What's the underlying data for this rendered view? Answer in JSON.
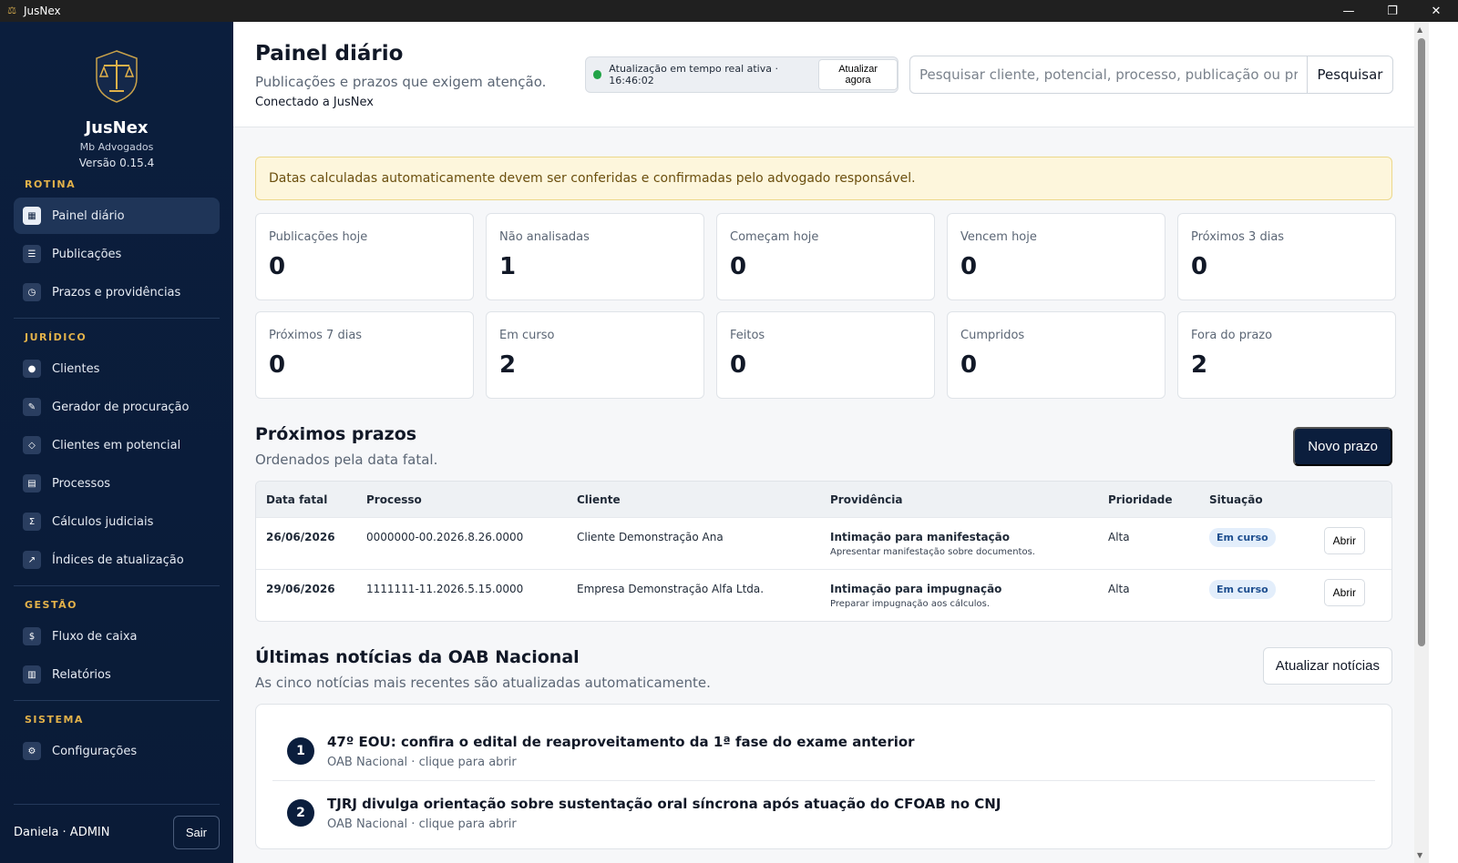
{
  "window": {
    "title": "JusNex",
    "minimize": "—",
    "restore": "❐",
    "close": "✕"
  },
  "sidebar": {
    "brand_name": "JusNex",
    "firm": "Mb Advogados",
    "version": "Versão 0.15.4",
    "sections": {
      "rotina": "ROTINA",
      "juridico": "JURÍDICO",
      "gestao": "GESTÃO",
      "sistema": "SISTEMA"
    },
    "items": {
      "painel": "Painel diário",
      "publicacoes": "Publicações",
      "prazos": "Prazos e providências",
      "clientes": "Clientes",
      "procuracao": "Gerador de procuração",
      "potencial": "Clientes em potencial",
      "processos": "Processos",
      "calculos": "Cálculos judiciais",
      "indices": "Índices de atualização",
      "fluxo": "Fluxo de caixa",
      "relatorios": "Relatórios",
      "config": "Configurações"
    },
    "user": "Daniela · ADMIN",
    "logout": "Sair"
  },
  "header": {
    "title": "Painel diário",
    "subtitle": "Publicações e prazos que exigem atenção.",
    "connection": "Conectado a JusNex",
    "realtime": "Atualização em tempo real ativa · 16:46:02",
    "refresh_now": "Atualizar agora",
    "search_placeholder": "Pesquisar cliente, potencial, processo, publicação ou prazo",
    "search_button": "Pesquisar"
  },
  "alert": "Datas calculadas automaticamente devem ser conferidas e confirmadas pelo advogado responsável.",
  "stats": [
    {
      "label": "Publicações hoje",
      "value": "0"
    },
    {
      "label": "Não analisadas",
      "value": "1"
    },
    {
      "label": "Começam hoje",
      "value": "0"
    },
    {
      "label": "Vencem hoje",
      "value": "0"
    },
    {
      "label": "Próximos 3 dias",
      "value": "0"
    },
    {
      "label": "Próximos 7 dias",
      "value": "0"
    },
    {
      "label": "Em curso",
      "value": "2"
    },
    {
      "label": "Feitos",
      "value": "0"
    },
    {
      "label": "Cumpridos",
      "value": "0"
    },
    {
      "label": "Fora do prazo",
      "value": "2"
    }
  ],
  "deadlines": {
    "title": "Próximos prazos",
    "subtitle": "Ordenados pela data fatal.",
    "new_button": "Novo prazo",
    "columns": [
      "Data fatal",
      "Processo",
      "Cliente",
      "Providência",
      "Prioridade",
      "Situação"
    ],
    "rows": [
      {
        "date": "26/06/2026",
        "process": "0000000-00.2026.8.26.0000",
        "client": "Cliente Demonstração Ana",
        "action": "Intimação para manifestação",
        "action_detail": "Apresentar manifestação sobre documentos.",
        "priority": "Alta",
        "status": "Em curso",
        "open": "Abrir"
      },
      {
        "date": "29/06/2026",
        "process": "1111111-11.2026.5.15.0000",
        "client": "Empresa Demonstração Alfa Ltda.",
        "action": "Intimação para impugnação",
        "action_detail": "Preparar impugnação aos cálculos.",
        "priority": "Alta",
        "status": "Em curso",
        "open": "Abrir"
      }
    ]
  },
  "news": {
    "title": "Últimas notícias da OAB Nacional",
    "subtitle": "As cinco notícias mais recentes são atualizadas automaticamente.",
    "refresh_button": "Atualizar notícias",
    "items": [
      {
        "num": "1",
        "title": "47º EOU: confira o edital de reaproveitamento da 1ª fase do exame anterior",
        "source": "OAB Nacional · clique para abrir"
      },
      {
        "num": "2",
        "title": "TJRJ divulga orientação sobre sustentação oral síncrona após atuação do CFOAB no CNJ",
        "source": "OAB Nacional · clique para abrir"
      }
    ]
  },
  "colors": {
    "sidebar": "#0b1e3d",
    "accent_gold": "#e3b24a",
    "alert_bg": "#fdf6dc",
    "badge_bg": "#e3eefb",
    "live_dot": "#22a447"
  }
}
